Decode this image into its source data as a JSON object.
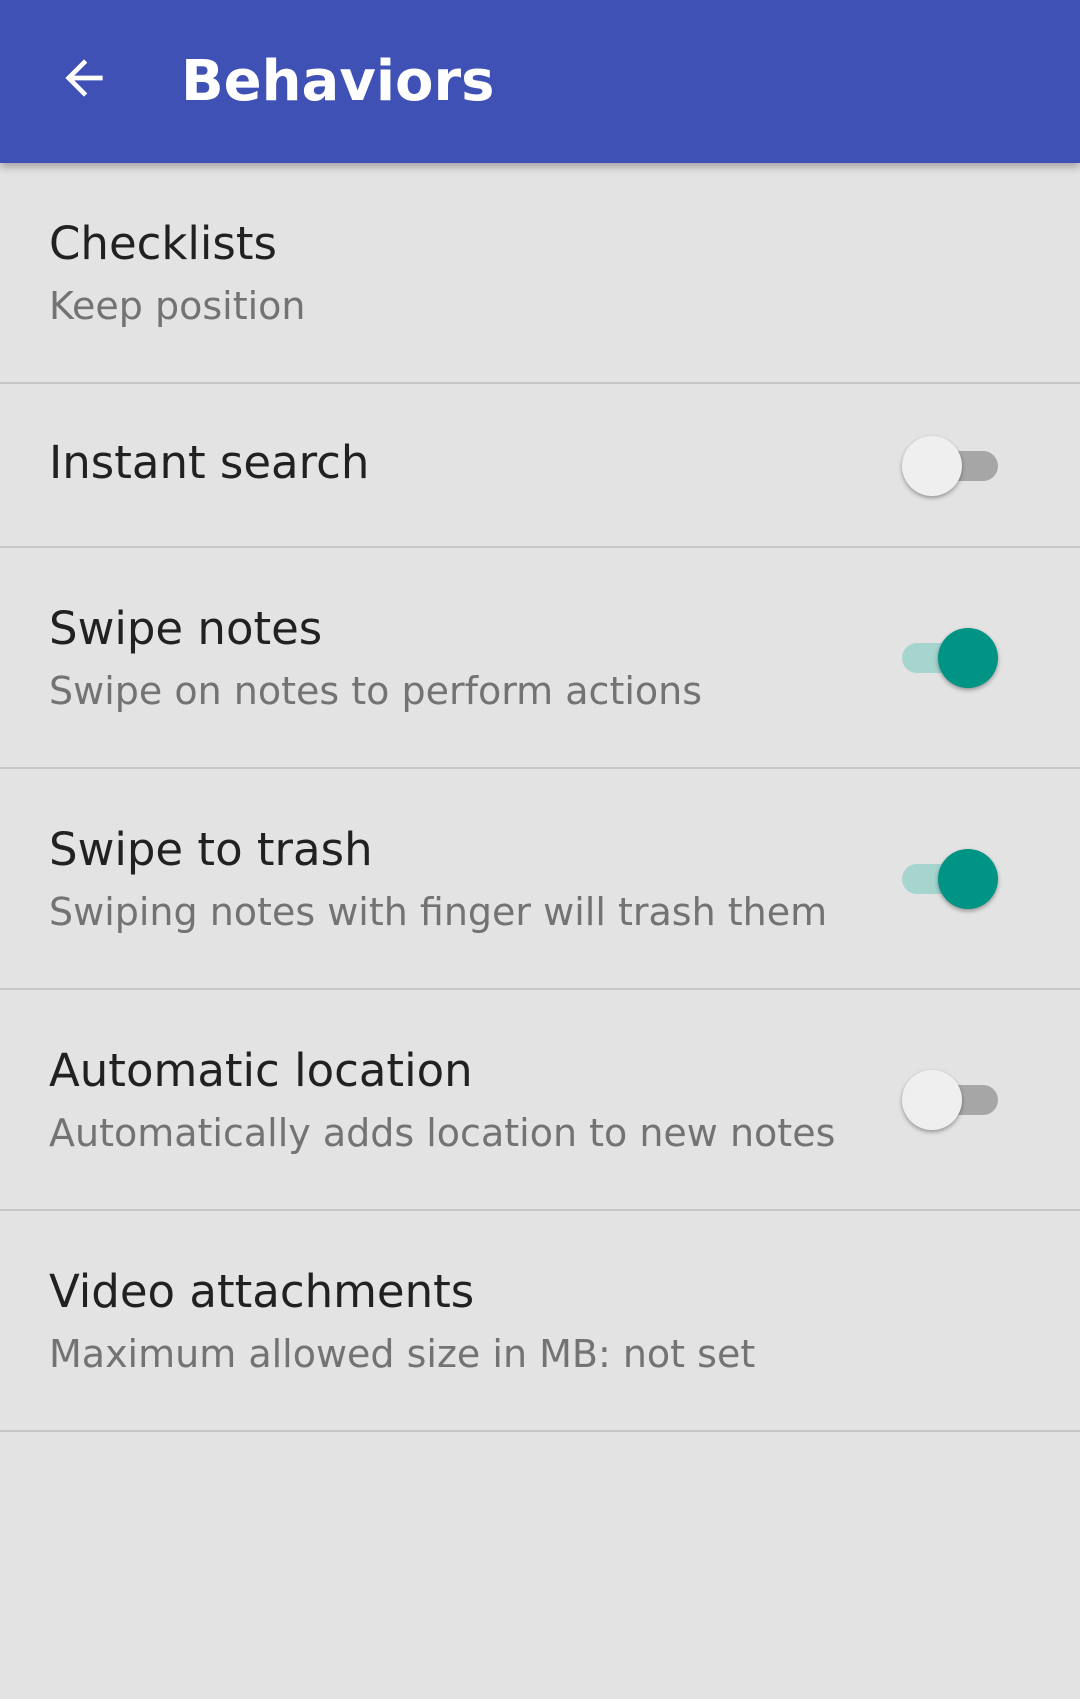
{
  "appbar": {
    "title": "Behaviors",
    "back_icon": "arrow-left-icon",
    "background": "#3f51b5"
  },
  "settings": [
    {
      "title": "Checklists",
      "summary": "Keep position"
    },
    {
      "title": "Instant search",
      "toggle": false
    },
    {
      "title": "Swipe notes",
      "summary": "Swipe on notes to perform actions",
      "toggle": true
    },
    {
      "title": "Swipe to trash",
      "summary": "Swiping notes with finger will trash them",
      "toggle": true
    },
    {
      "title": "Automatic location",
      "summary": "Automatically adds location to new notes",
      "toggle": false
    },
    {
      "title": "Video attachments",
      "summary": "Maximum allowed size in MB: not set"
    }
  ],
  "colors": {
    "accent": "#009485",
    "accent_track": "#a6d4ce",
    "background": "#e3e3e3"
  }
}
